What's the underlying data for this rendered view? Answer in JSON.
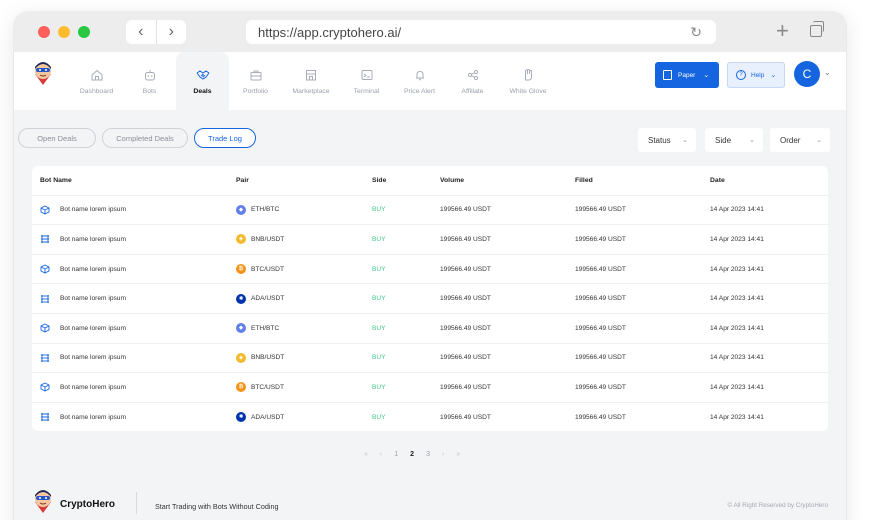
{
  "browser": {
    "url": "https://app.cryptohero.ai/"
  },
  "nav": {
    "items": [
      {
        "label": "Dashboard",
        "icon": "home-icon"
      },
      {
        "label": "Bots",
        "icon": "robot-icon"
      },
      {
        "label": "Deals",
        "icon": "handshake-icon"
      },
      {
        "label": "Portfolio",
        "icon": "briefcase-icon"
      },
      {
        "label": "Marketplace",
        "icon": "store-icon"
      },
      {
        "label": "Terminal",
        "icon": "terminal-icon"
      },
      {
        "label": "Price Alert",
        "icon": "bell-icon"
      },
      {
        "label": "Affiliate",
        "icon": "share-icon"
      },
      {
        "label": "White Glove",
        "icon": "glove-icon"
      }
    ],
    "active": "Deals"
  },
  "header": {
    "paper_label": "Paper",
    "help_label": "Help",
    "avatar_initial": "C",
    "accent_color": "#1565e0"
  },
  "filters": {
    "tabs": [
      "Open Deals",
      "Completed Deals",
      "Trade Log"
    ],
    "active_tab": "Trade Log",
    "status": "Status",
    "side": "Side",
    "order": "Order"
  },
  "table": {
    "headers": [
      "Bot Name",
      "Pair",
      "Side",
      "Volume",
      "Filled",
      "Date"
    ],
    "rows": [
      {
        "bot_icon": "cube-icon",
        "name": "Bot name lorem ipsum",
        "coin": "eth",
        "pair": "ETH/BTC",
        "side": "BUY",
        "volume": "199566.49 USDT",
        "filled": "199566.49 USDT",
        "date": "14 Apr 2023 14:41"
      },
      {
        "bot_icon": "grid-icon",
        "name": "Bot name lorem ipsum",
        "coin": "bnb",
        "pair": "BNB/USDT",
        "side": "BUY",
        "volume": "199566.49 USDT",
        "filled": "199566.49 USDT",
        "date": "14 Apr 2023 14:41"
      },
      {
        "bot_icon": "cube-icon",
        "name": "Bot name lorem ipsum",
        "coin": "btc",
        "pair": "BTC/USDT",
        "side": "BUY",
        "volume": "199566.49 USDT",
        "filled": "199566.49 USDT",
        "date": "14 Apr 2023 14:41"
      },
      {
        "bot_icon": "grid-icon",
        "name": "Bot name lorem ipsum",
        "coin": "ada",
        "pair": "ADA/USDT",
        "side": "BUY",
        "volume": "199566.49 USDT",
        "filled": "199566.49 USDT",
        "date": "14 Apr 2023 14:41"
      },
      {
        "bot_icon": "cube-icon",
        "name": "Bot name lorem ipsum",
        "coin": "eth",
        "pair": "ETH/BTC",
        "side": "BUY",
        "volume": "199566.49 USDT",
        "filled": "199566.49 USDT",
        "date": "14 Apr 2023 14:41"
      },
      {
        "bot_icon": "grid-icon",
        "name": "Bot name lorem ipsum",
        "coin": "bnb",
        "pair": "BNB/USDT",
        "side": "BUY",
        "volume": "199566.49 USDT",
        "filled": "199566.49 USDT",
        "date": "14 Apr 2023 14:41"
      },
      {
        "bot_icon": "cube-icon",
        "name": "Bot name lorem ipsum",
        "coin": "btc",
        "pair": "BTC/USDT",
        "side": "BUY",
        "volume": "199566.49 USDT",
        "filled": "199566.49 USDT",
        "date": "14 Apr 2023 14:41"
      },
      {
        "bot_icon": "grid-icon",
        "name": "Bot name lorem ipsum",
        "coin": "ada",
        "pair": "ADA/USDT",
        "side": "BUY",
        "volume": "199566.49 USDT",
        "filled": "199566.49 USDT",
        "date": "14 Apr 2023 14:41"
      }
    ],
    "coin_colors": {
      "eth": "#627eea",
      "bnb": "#f3ba2f",
      "btc": "#f7931a",
      "ada": "#0033ad"
    },
    "buy_color": "#42c98d"
  },
  "pagination": {
    "first": "«",
    "prev": "‹",
    "pages": [
      "1",
      "2",
      "3"
    ],
    "current": "2",
    "next": "›",
    "last": "»"
  },
  "footer": {
    "brand": "CryptoHero",
    "tagline": "Start Trading with Bots Without Coding",
    "copyright": "© All Right Reserved by CryptoHero"
  }
}
